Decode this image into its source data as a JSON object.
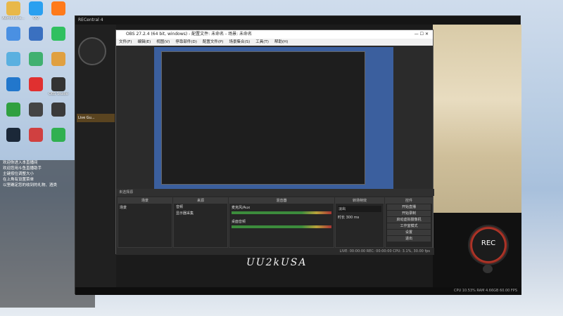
{
  "desktop": {
    "icons": [
      {
        "label": "Administra...",
        "color": "#e8b84a"
      },
      {
        "label": "QQ",
        "color": "#2aa0f0"
      },
      {
        "label": "",
        "color": "#ff7a1a"
      },
      {
        "label": "",
        "color": "#4a90e2"
      },
      {
        "label": "",
        "color": "#3a70c0"
      },
      {
        "label": "",
        "color": "#30c060"
      },
      {
        "label": "",
        "color": "#5ab0e0"
      },
      {
        "label": "",
        "color": "#40b070"
      },
      {
        "label": "",
        "color": "#e0a040"
      },
      {
        "label": "",
        "color": "#2277cc"
      },
      {
        "label": "",
        "color": "#e03030"
      },
      {
        "label": "OBS Studio",
        "color": "#333"
      },
      {
        "label": "",
        "color": "#30a040"
      },
      {
        "label": "",
        "color": "#444"
      },
      {
        "label": "",
        "color": "#3a3a3a"
      },
      {
        "label": "",
        "color": "#1b2838"
      },
      {
        "label": "",
        "color": "#d04040"
      },
      {
        "label": "",
        "color": "#30b050"
      }
    ]
  },
  "chat": {
    "lines": [
      "",
      "",
      "",
      "欢迎你进入本直播间",
      "",
      "",
      "欢迎您用斗鱼直播助手",
      "主键按住调整大小",
      "在上角有设置菜单",
      "",
      "",
      "以室确定您的收到的礼物、酒类",
      "",
      ""
    ]
  },
  "recentral": {
    "title": "RECentral 4",
    "sidebar_label": "Live Gu...",
    "rec_label": "REC",
    "status": "CPU 10.53% RAM 4.66GB 60.00 FPS"
  },
  "obs": {
    "title": "OBS 27.2.4 (64 bit, windows) - 配置文件: 未命名 - 场景: 未命名",
    "menu": [
      "文件(F)",
      "编辑(E)",
      "视图(V)",
      "停靠部件(D)",
      "配置文件(P)",
      "场景集合(S)",
      "工具(T)",
      "帮助(H)"
    ],
    "panels": {
      "scenes": "场景",
      "sources": "来源",
      "mixer": "混音器",
      "transitions": "转场特效",
      "controls": "控件"
    },
    "scene_item": "场景",
    "sources": [
      "音频",
      "显示器采集"
    ],
    "transition": "淡出",
    "duration_label": "时长",
    "duration_value": "300 ms",
    "controls": [
      "开始直播",
      "开始录制",
      "启动虚拟摄像机",
      "工作室模式",
      "设置",
      "退出"
    ],
    "status": "LIVE: 00:00:00   REC: 00:00:00   CPU: 3.1%, 30.00 fps",
    "source_label": "未选择源",
    "mixer_rows": [
      "麦克风/Aux",
      "桌面音频"
    ]
  },
  "overlay_text": "UU2kUSA"
}
